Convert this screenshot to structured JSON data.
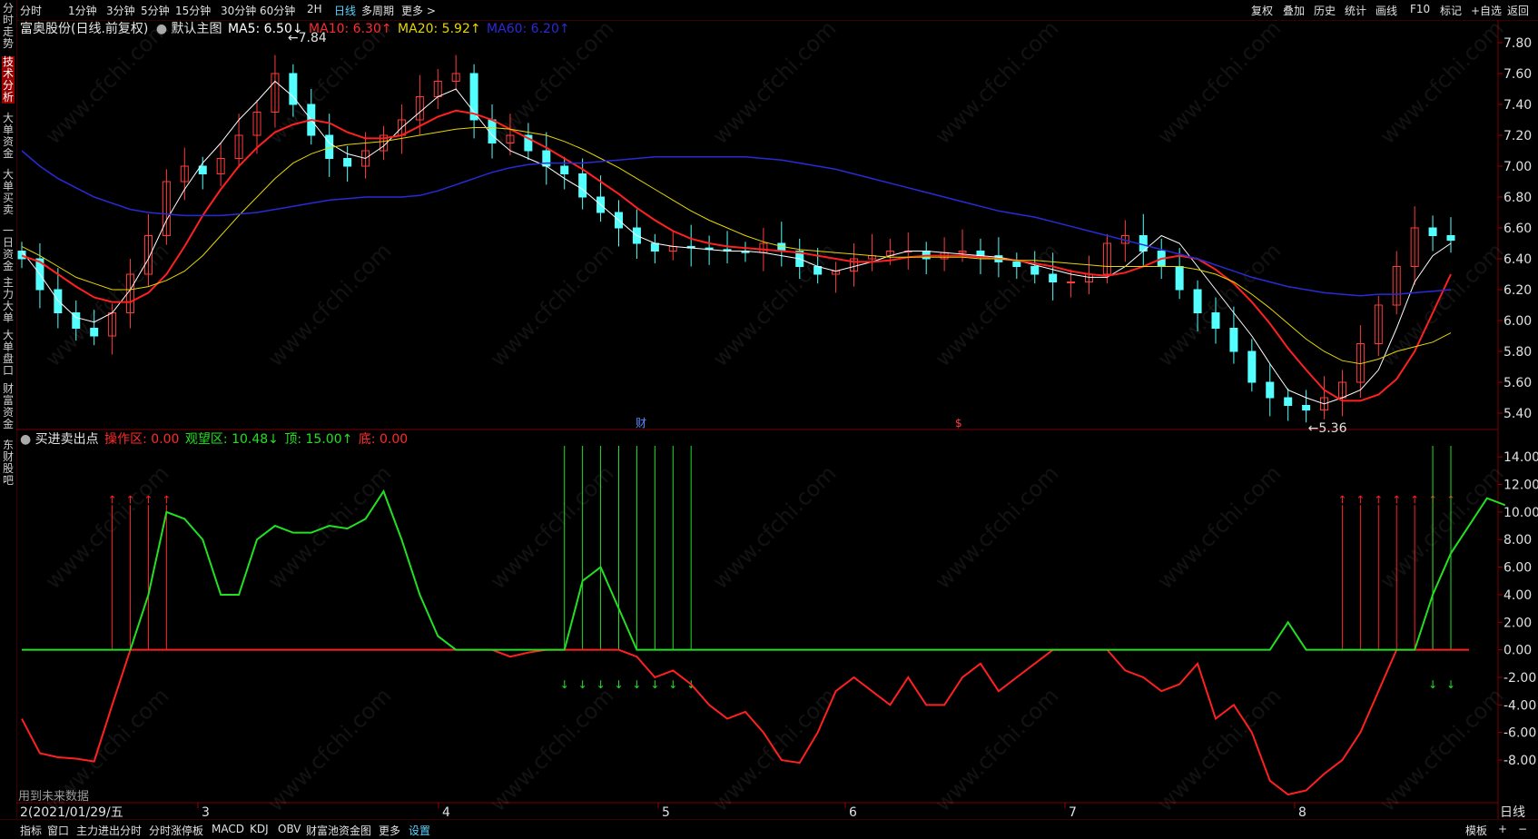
{
  "toolbar": {
    "periods": [
      "分时",
      "1分钟",
      "3分钟",
      "5分钟",
      "15分钟",
      "30分钟",
      "60分钟",
      "2H",
      "日线",
      "多周期",
      "更多 >"
    ],
    "active_period": "日线",
    "right_items": [
      "复权",
      "叠加",
      "历史",
      "统计",
      "画线",
      "F10",
      "标记",
      "+自选",
      "返回"
    ]
  },
  "sidebar": {
    "items": [
      "分时走势",
      "技术分析",
      "大单资金",
      "大单买卖",
      "一日资金",
      "主力大单",
      "大单盘口",
      "财富资金",
      "东财股吧"
    ],
    "active": "技术分析"
  },
  "main_legend": {
    "stock": "富奥股份(日线.前复权)",
    "indicator_name": "默认主图",
    "ma5": "MA5: 6.50↓",
    "ma10": "MA10: 6.30↑",
    "ma20": "MA20: 5.92↑",
    "ma60": "MA60: 6.20↑"
  },
  "sub_legend": {
    "name": "买进卖出点",
    "operate": "操作区: 0.00",
    "watch": "观望区: 10.48↓",
    "top": "顶: 15.00↑",
    "bottom": "底: 0.00"
  },
  "price_axis": [
    "7.80",
    "7.60",
    "7.40",
    "7.20",
    "7.00",
    "6.80",
    "6.60",
    "6.40",
    "6.20",
    "6.00",
    "5.80",
    "5.60",
    "5.40"
  ],
  "sub_axis": [
    "14.00",
    "12.00",
    "10.00",
    "8.00",
    "6.00",
    "4.00",
    "2.00",
    "0.00",
    "-2.00",
    "-4.00",
    "-6.00",
    "-8.00"
  ],
  "annotations": {
    "high": "7.84",
    "low": "5.36",
    "fin1": "财",
    "fin2": "$"
  },
  "future_data_note": "用到未来数据",
  "time_axis": {
    "first": "2(2021/01/29/五",
    "months": [
      "3",
      "4",
      "5",
      "6",
      "7",
      "8"
    ]
  },
  "period_label": "日线",
  "bottom_tabs": [
    "指标",
    "窗口",
    "主力进出分时",
    "分时涨停板",
    "MACD",
    "KDJ",
    "OBV",
    "财富池资金图",
    "更多",
    "设置"
  ],
  "bottom_active": "设置",
  "bottom_right": [
    "模板",
    "+",
    "−"
  ],
  "watermark": "www.cfchi.com",
  "colors": {
    "up": "#ff3b3b",
    "down": "#54ffff",
    "ma5": "#ffffff",
    "ma10": "#ff2020",
    "ma20": "#e6d600",
    "ma60": "#2a2ad8",
    "green": "#22e022",
    "red": "#ff2020"
  },
  "chart_data": [
    {
      "type": "candlestick",
      "title": "富奥股份(日线.前复权)",
      "ylim": [
        5.3,
        7.9
      ],
      "series": [
        {
          "name": "MA5",
          "values": [
            6.45,
            6.3,
            6.13,
            6.02,
            5.99,
            6.05,
            6.2,
            6.4,
            6.65,
            6.85,
            7.02,
            7.15,
            7.3,
            7.42,
            7.55,
            7.45,
            7.3,
            7.15,
            7.08,
            7.05,
            7.13,
            7.25,
            7.35,
            7.45,
            7.5,
            7.35,
            7.2,
            7.1,
            7.05,
            7.0,
            6.92,
            6.85,
            6.75,
            6.65,
            6.55,
            6.5,
            6.48,
            6.47,
            6.46,
            6.45,
            6.45,
            6.44,
            6.42,
            6.4,
            6.35,
            6.32,
            6.35,
            6.38,
            6.42,
            6.45,
            6.45,
            6.44,
            6.43,
            6.42,
            6.41,
            6.39,
            6.36,
            6.33,
            6.3,
            6.28,
            6.28,
            6.35,
            6.45,
            6.55,
            6.5,
            6.35,
            6.2,
            6.05,
            5.9,
            5.72,
            5.55,
            5.5,
            5.46,
            5.5,
            5.55,
            5.68,
            5.95,
            6.25,
            6.42,
            6.5
          ]
        },
        {
          "name": "MA10",
          "values": [
            6.42,
            6.38,
            6.3,
            6.22,
            6.15,
            6.12,
            6.12,
            6.18,
            6.3,
            6.48,
            6.68,
            6.85,
            7.0,
            7.12,
            7.22,
            7.27,
            7.3,
            7.28,
            7.22,
            7.18,
            7.18,
            7.2,
            7.26,
            7.32,
            7.36,
            7.34,
            7.3,
            7.24,
            7.18,
            7.12,
            7.05,
            6.98,
            6.9,
            6.82,
            6.73,
            6.65,
            6.58,
            6.53,
            6.5,
            6.48,
            6.47,
            6.46,
            6.45,
            6.44,
            6.42,
            6.4,
            6.38,
            6.38,
            6.39,
            6.41,
            6.42,
            6.42,
            6.42,
            6.41,
            6.4,
            6.39,
            6.37,
            6.35,
            6.32,
            6.3,
            6.29,
            6.31,
            6.35,
            6.4,
            6.42,
            6.4,
            6.33,
            6.24,
            6.12,
            5.98,
            5.82,
            5.68,
            5.55,
            5.48,
            5.48,
            5.52,
            5.62,
            5.8,
            6.05,
            6.3
          ]
        },
        {
          "name": "MA20",
          "values": [
            6.48,
            6.42,
            6.35,
            6.28,
            6.24,
            6.2,
            6.2,
            6.22,
            6.26,
            6.32,
            6.42,
            6.55,
            6.68,
            6.8,
            6.92,
            7.02,
            7.08,
            7.12,
            7.14,
            7.15,
            7.16,
            7.18,
            7.2,
            7.22,
            7.24,
            7.25,
            7.25,
            7.24,
            7.22,
            7.2,
            7.16,
            7.11,
            7.05,
            6.99,
            6.92,
            6.85,
            6.78,
            6.71,
            6.65,
            6.6,
            6.55,
            6.51,
            6.48,
            6.46,
            6.45,
            6.44,
            6.43,
            6.42,
            6.41,
            6.41,
            6.41,
            6.41,
            6.41,
            6.4,
            6.4,
            6.39,
            6.39,
            6.38,
            6.37,
            6.36,
            6.35,
            6.35,
            6.35,
            6.35,
            6.35,
            6.33,
            6.3,
            6.25,
            6.17,
            6.08,
            5.98,
            5.88,
            5.8,
            5.74,
            5.72,
            5.75,
            5.8,
            5.83,
            5.86,
            5.92
          ]
        },
        {
          "name": "MA60",
          "values": [
            7.1,
            7.0,
            6.92,
            6.86,
            6.8,
            6.76,
            6.72,
            6.7,
            6.69,
            6.68,
            6.68,
            6.68,
            6.69,
            6.7,
            6.72,
            6.74,
            6.76,
            6.78,
            6.79,
            6.8,
            6.8,
            6.8,
            6.81,
            6.84,
            6.88,
            6.92,
            6.96,
            6.99,
            7.01,
            7.02,
            7.02,
            7.02,
            7.03,
            7.04,
            7.05,
            7.06,
            7.06,
            7.06,
            7.06,
            7.06,
            7.06,
            7.05,
            7.04,
            7.02,
            7.0,
            6.98,
            6.95,
            6.92,
            6.89,
            6.86,
            6.83,
            6.8,
            6.77,
            6.74,
            6.71,
            6.69,
            6.67,
            6.64,
            6.61,
            6.58,
            6.55,
            6.52,
            6.49,
            6.46,
            6.43,
            6.4,
            6.36,
            6.32,
            6.28,
            6.25,
            6.22,
            6.2,
            6.18,
            6.17,
            6.16,
            6.17,
            6.17,
            6.18,
            6.19,
            6.2
          ]
        }
      ],
      "close": [
        6.4,
        6.2,
        6.05,
        5.95,
        5.9,
        6.05,
        6.3,
        6.55,
        6.9,
        7.0,
        6.95,
        7.05,
        7.2,
        7.35,
        7.6,
        7.4,
        7.2,
        7.05,
        7.0,
        7.1,
        7.2,
        7.3,
        7.45,
        7.55,
        7.6,
        7.3,
        7.15,
        7.2,
        7.1,
        7.0,
        6.95,
        6.8,
        6.7,
        6.6,
        6.5,
        6.45,
        6.48,
        6.47,
        6.46,
        6.45,
        6.44,
        6.5,
        6.45,
        6.35,
        6.3,
        6.32,
        6.4,
        6.42,
        6.45,
        6.45,
        6.4,
        6.44,
        6.45,
        6.42,
        6.38,
        6.35,
        6.3,
        6.25,
        6.25,
        6.3,
        6.5,
        6.55,
        6.45,
        6.35,
        6.2,
        6.05,
        5.95,
        5.8,
        5.6,
        5.5,
        5.45,
        5.42,
        5.5,
        5.6,
        5.85,
        6.1,
        6.35,
        6.6,
        6.55,
        6.52
      ]
    },
    {
      "type": "line",
      "title": "买进卖出点",
      "ylim": [
        -10.5,
        15
      ],
      "series": [
        {
          "name": "观望区",
          "values": [
            0,
            0,
            0,
            0,
            0,
            0,
            0,
            4,
            10,
            9.5,
            8,
            4,
            4,
            8,
            9,
            8.5,
            8.5,
            9,
            8.8,
            9.5,
            11.5,
            8,
            4,
            1,
            0,
            0,
            0,
            0,
            0,
            0,
            0,
            5,
            6,
            3,
            0,
            0,
            0,
            0,
            0,
            0,
            0,
            0,
            0,
            0,
            0,
            0,
            0,
            0,
            0,
            0,
            0,
            0,
            0,
            0,
            0,
            0,
            0,
            0,
            0,
            0,
            0,
            0,
            0,
            0,
            0,
            0,
            0,
            0,
            0,
            0,
            2,
            0,
            0,
            0,
            0,
            0,
            0,
            0,
            4,
            7,
            9,
            11,
            10.5
          ]
        },
        {
          "name": "操作区",
          "values": [
            -5,
            -7.5,
            -7.8,
            -7.9,
            -8.1,
            -4,
            0,
            0,
            0,
            0,
            0,
            0,
            0,
            0,
            0,
            0,
            0,
            0,
            0,
            0,
            0,
            0,
            0,
            0,
            0,
            0,
            0,
            -0.5,
            -0.2,
            0,
            0,
            0,
            0,
            0,
            -0.5,
            -2,
            -1.5,
            -2.5,
            -4,
            -5,
            -4.5,
            -6,
            -8,
            -8.2,
            -6,
            -3,
            -2,
            -3,
            -4,
            -2,
            -4,
            -4,
            -2,
            -1,
            -3,
            -2,
            -1,
            0,
            0,
            0,
            0,
            -1.5,
            -2,
            -3,
            -2.5,
            -1,
            -5,
            -4,
            -6,
            -9.5,
            -10.5,
            -10.2,
            -9,
            -8,
            -6,
            -3,
            0,
            0,
            0,
            0,
            0
          ]
        },
        {
          "name": "顶",
          "values": [
            15
          ]
        },
        {
          "name": "底",
          "values": [
            0
          ]
        }
      ]
    }
  ]
}
